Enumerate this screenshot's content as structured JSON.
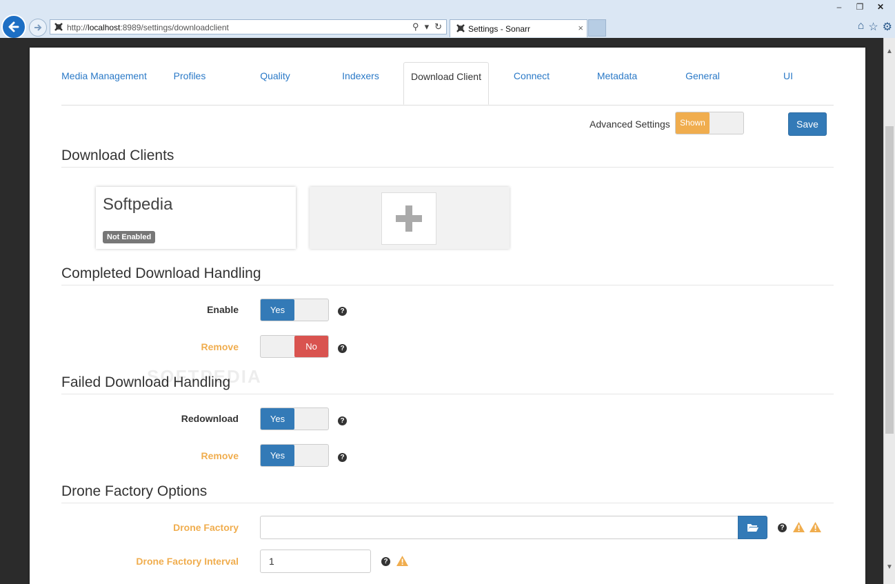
{
  "browser": {
    "url_prefix": "http://",
    "url_host": "localhost",
    "url_rest": ":8989/settings/downloadclient",
    "tab_title": "Settings - Sonarr",
    "tab_close": "×",
    "win_minimize": "–",
    "win_restore": "❐",
    "win_close": "✕"
  },
  "tabs": [
    {
      "label": "Media Management"
    },
    {
      "label": "Profiles"
    },
    {
      "label": "Quality"
    },
    {
      "label": "Indexers"
    },
    {
      "label": "Download Client",
      "active": true
    },
    {
      "label": "Connect"
    },
    {
      "label": "Metadata"
    },
    {
      "label": "General"
    },
    {
      "label": "UI"
    }
  ],
  "advanced": {
    "label": "Advanced Settings",
    "state": "Shown"
  },
  "save_label": "Save",
  "sections": {
    "download_clients": "Download Clients",
    "completed": "Completed Download Handling",
    "failed": "Failed Download Handling",
    "drone": "Drone Factory Options"
  },
  "client": {
    "name": "Softpedia",
    "badge": "Not Enabled"
  },
  "completed": {
    "enable": {
      "label": "Enable",
      "value": "Yes"
    },
    "remove": {
      "label": "Remove",
      "value": "No"
    }
  },
  "failed": {
    "redownload": {
      "label": "Redownload",
      "value": "Yes"
    },
    "remove": {
      "label": "Remove",
      "value": "Yes"
    }
  },
  "drone": {
    "factory_label": "Drone Factory",
    "factory_value": "",
    "interval_label": "Drone Factory Interval",
    "interval_value": "1"
  },
  "help_glyph": "?",
  "watermark": "SOFTPEDIA",
  "colors": {
    "primary": "#337ab7",
    "warning": "#f0ad4e",
    "danger": "#d9534f",
    "link": "#2a79c7"
  }
}
